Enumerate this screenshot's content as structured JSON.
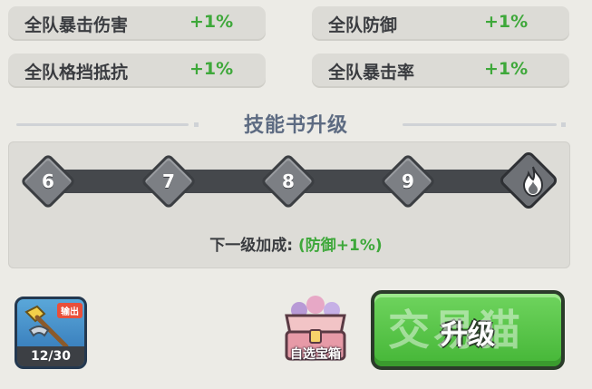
{
  "stats": [
    {
      "name": "全队暴击伤害",
      "value": "+1%"
    },
    {
      "name": "全队防御",
      "value": "+1%"
    },
    {
      "name": "全队格挡抵抗",
      "value": "+1%"
    },
    {
      "name": "全队暴击率",
      "value": "+1%"
    }
  ],
  "section_title": "技能书升级",
  "levels": [
    "6",
    "7",
    "8",
    "9"
  ],
  "max_level_icon": "flame-icon",
  "next_bonus": {
    "label": "下一级加成:",
    "value": "(防御+1%)"
  },
  "item": {
    "tag": "输出",
    "count": "12/30",
    "icon": "pickaxe-scroll-icon"
  },
  "chest": {
    "label": "自选宝箱",
    "icon": "treasure-chest-icon"
  },
  "upgrade_button": {
    "label": "升级"
  },
  "watermark": "交易猫",
  "colors": {
    "accent_green": "#3ea83a",
    "button_green": "#55c447",
    "title_blue": "#5d6b82"
  }
}
